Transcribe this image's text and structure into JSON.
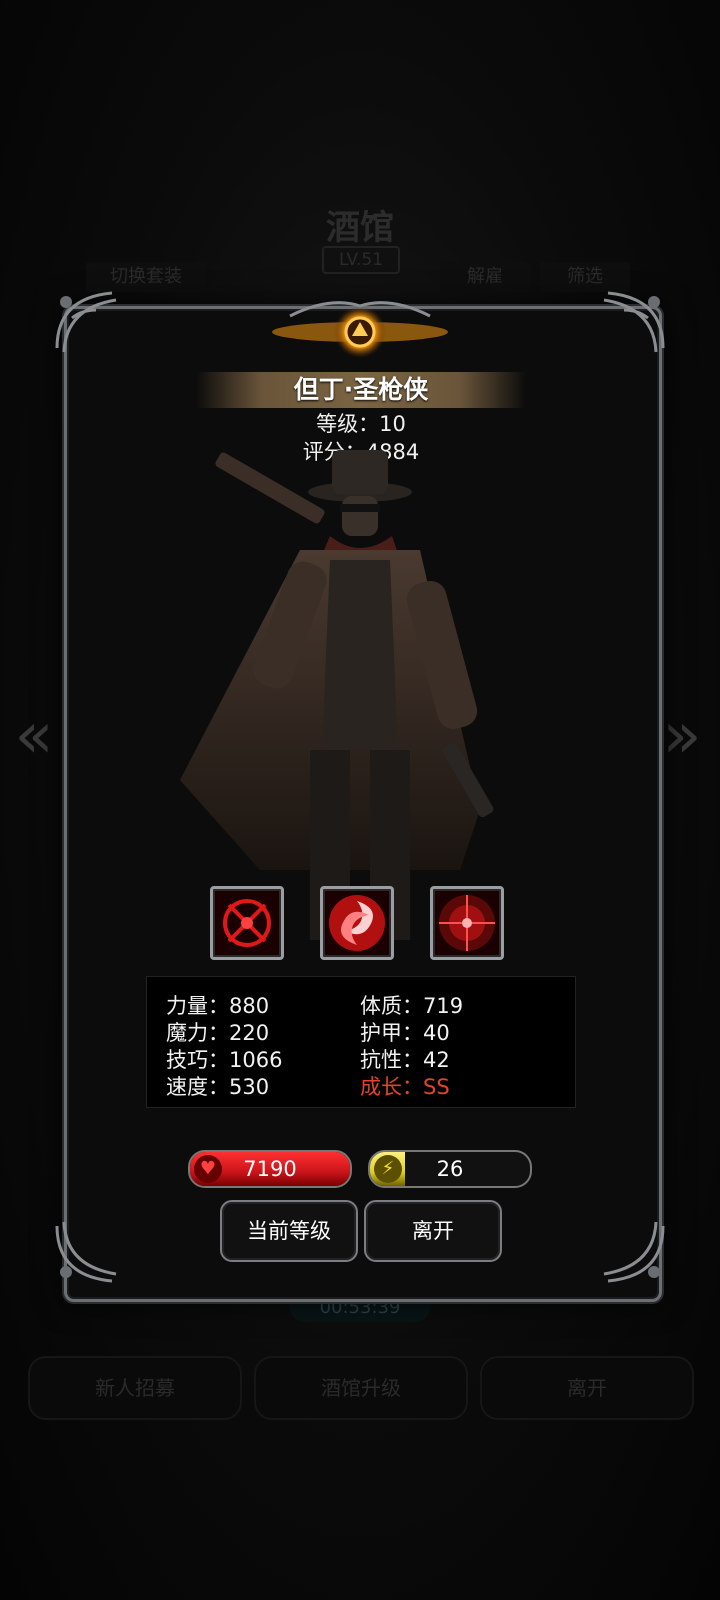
{
  "background": {
    "title": "酒馆",
    "level": "LV.51",
    "chips": [
      "切换套装",
      "解雇",
      "筛选"
    ],
    "timer": "00:53:39",
    "buttons": [
      "新人招募",
      "酒馆升级",
      "离开"
    ]
  },
  "hero": {
    "name": "但丁·圣枪侠",
    "level_label": "等级：10",
    "score_label": "评分：4884"
  },
  "skills": [
    {
      "icon": "crosshair-skill-icon"
    },
    {
      "icon": "red-swirl-skill-icon"
    },
    {
      "icon": "target-skill-icon"
    }
  ],
  "stats": {
    "strength": "力量：880",
    "magic": "魔力：220",
    "skill": "技巧：1066",
    "speed": "速度：530",
    "constitution": "体质：719",
    "armor": "护甲：40",
    "resistance": "抗性：42",
    "growth": "成长：SS"
  },
  "bars": {
    "health": {
      "value": "7190",
      "fill": 1.0,
      "color": "#c8141a"
    },
    "energy": {
      "value": "26",
      "fill": 0.22,
      "color": "#e0d020"
    }
  },
  "actions": {
    "current_level": "当前等级",
    "leave": "离开"
  }
}
